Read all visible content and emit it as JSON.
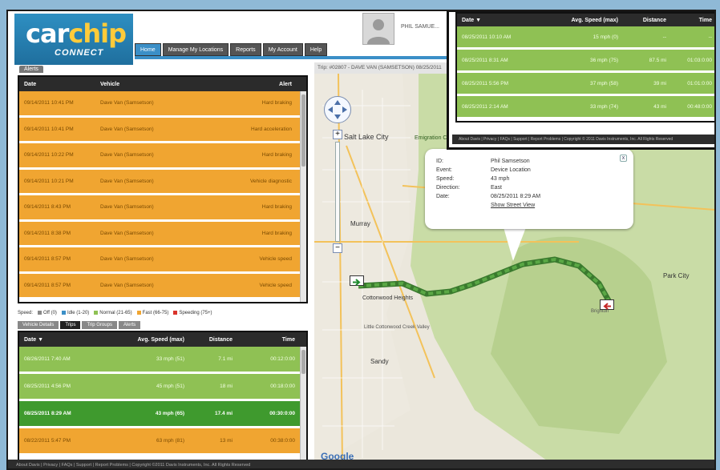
{
  "brand": {
    "name_part1": "car",
    "name_part2": "chip",
    "tagline": "CONNECT"
  },
  "nav": [
    "Home",
    "Manage My Locations",
    "Reports",
    "My Account",
    "Help"
  ],
  "user": {
    "name": "PHIL SAMUE..."
  },
  "alerts": {
    "tab": "Alerts",
    "headers": [
      "Date",
      "Vehicle",
      "Alert"
    ],
    "rows": [
      [
        "09/14/2011 10:41 PM",
        "Dave Van (Samsetson)",
        "Hard braking"
      ],
      [
        "09/14/2011 10:41 PM",
        "Dave Van (Samsetson)",
        "Hard acceleration"
      ],
      [
        "09/14/2011 10:22 PM",
        "Dave Van (Samsetson)",
        "Hard braking"
      ],
      [
        "09/14/2011 10:21 PM",
        "Dave Van (Samsetson)",
        "Vehicle diagnostic"
      ],
      [
        "09/14/2011 8:43 PM",
        "Dave Van (Samsetson)",
        "Hard braking"
      ],
      [
        "09/14/2011 8:38 PM",
        "Dave Van (Samsetson)",
        "Hard braking"
      ],
      [
        "09/14/2011 8:57 PM",
        "Dave Van (Samsetson)",
        "Vehicle speed"
      ],
      [
        "09/14/2011 8:57 PM",
        "Dave Van (Samsetson)",
        "Vehicle speed"
      ]
    ]
  },
  "legend": [
    {
      "label": "Off (0)",
      "color": "#888888"
    },
    {
      "label": "Idle (1-20)",
      "color": "#3b8fc7"
    },
    {
      "label": "Normal (21-65)",
      "color": "#8fc154"
    },
    {
      "label": "Fast (66-75)",
      "color": "#f0a531"
    },
    {
      "label": "Speeding (75+)",
      "color": "#d9342b"
    }
  ],
  "subtabs": [
    "Vehicle Details",
    "Trips",
    "Trip Groups",
    "Alerts"
  ],
  "trips": {
    "headers": [
      "Date ▼",
      "Avg. Speed (max)",
      "Distance",
      "Time"
    ],
    "rows": [
      [
        "08/26/2011 7:40 AM",
        "33 mph (51)",
        "7.1 mi",
        "00:12:0:00"
      ],
      [
        "08/25/2011 4:56 PM",
        "45 mph (51)",
        "18 mi",
        "00:18:0:00"
      ],
      [
        "08/25/2011 8:29 AM",
        "43 mph (65)",
        "17.4 mi",
        "00:30:0:00"
      ],
      [
        "08/22/2011 5:47 PM",
        "63 mph (81)",
        "13 mi",
        "00:38:0:00"
      ]
    ]
  },
  "map": {
    "title": "Trip: #02807 - DAVE VAN (SAMSETSON) 08/25/2011",
    "google": "Google"
  },
  "popup": {
    "fields": [
      [
        "ID:",
        "Phil Samsetson"
      ],
      [
        "Event:",
        "Device Location"
      ],
      [
        "Speed:",
        "43 mph"
      ],
      [
        "Direction:",
        "East"
      ],
      [
        "Date:",
        "08/25/2011 8:29 AM"
      ]
    ],
    "link": "Show Street View",
    "close": "x"
  },
  "map_labels": [
    "Salt Lake City",
    "Murray",
    "Sandy",
    "Emigration Canyon",
    "Park City",
    "Cottonwood Heights",
    "Little Cottonwood Creek Valley",
    "Brighton"
  ],
  "overlay": {
    "headers": [
      "Date ▼",
      "Avg. Speed (max)",
      "Distance",
      "Time"
    ],
    "rows": [
      [
        "08/25/2011 10:10 AM",
        "15 mph (0)",
        "--",
        "--"
      ],
      [
        "08/25/2011 8:31 AM",
        "36 mph (75)",
        "87.5 mi",
        "01:03:0:00"
      ],
      [
        "08/25/2011 5:56 PM",
        "37 mph (58)",
        "39 mi",
        "01:01:0:00"
      ],
      [
        "08/25/2011 2:14 AM",
        "33 mph (74)",
        "43 mi",
        "00:48:0:00"
      ]
    ],
    "footer": "About Davis | Privacy | FAQs | Support | Report Problems | Copyright © 2011 Davis Instruments, Inc. All Rights Reserved"
  },
  "footer": "About Davis | Privacy | FAQs | Support | Report Problems | Copyright ©2011 Davis Instruments, Inc. All Rights Reserved"
}
